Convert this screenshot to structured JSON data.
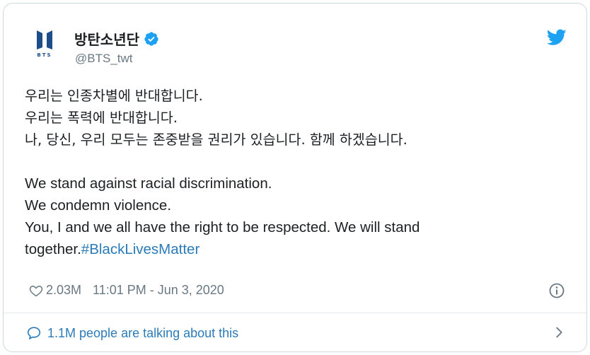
{
  "author": {
    "display_name": "방탄소년단",
    "handle": "@BTS_twt",
    "avatar_text": "BTS",
    "verified": true,
    "avatar_icon": "bts-logo-icon"
  },
  "tweet": {
    "korean_lines": [
      "우리는 인종차별에 반대합니다.",
      "우리는 폭력에 반대합니다.",
      "나, 당신, 우리 모두는 존중받을 권리가 있습니다. 함께 하겠습니다."
    ],
    "english_lines": [
      "We stand against racial discrimination.",
      "We condemn violence.",
      "You, I and we all have the right to be respected. We will stand"
    ],
    "last_line_text": "together.",
    "hashtag": "#BlackLivesMatter"
  },
  "meta": {
    "likes": "2.03M",
    "timestamp": "11:01 PM - Jun 3, 2020"
  },
  "footer": {
    "conversation_label": "1.1M people are talking about this"
  },
  "colors": {
    "link": "#2b7bb9",
    "verified_blue": "#1da1f2",
    "muted": "#697882",
    "border": "#cfd9de"
  }
}
